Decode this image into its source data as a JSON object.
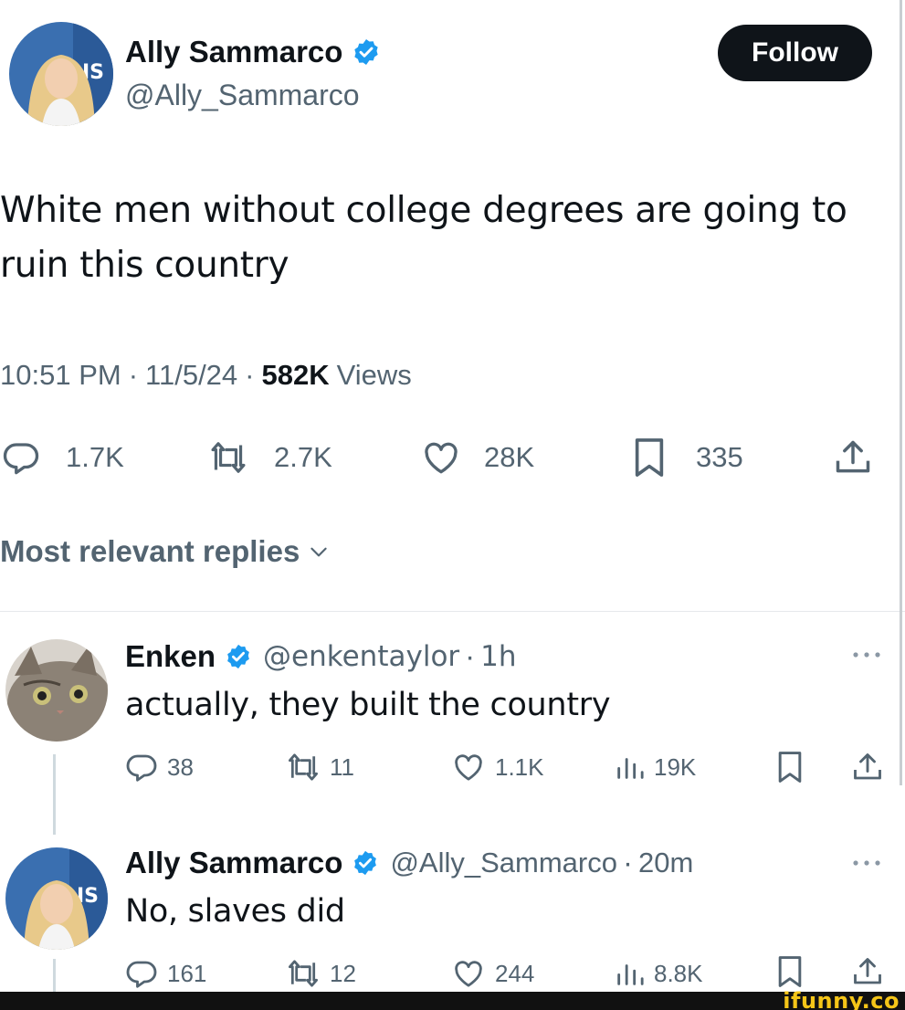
{
  "tweet": {
    "author_name": "Ally Sammarco",
    "handle": "@Ally_Sammarco",
    "follow_label": "Follow",
    "text_line1": "White men without college degrees are going to",
    "text_line2": "ruin this country",
    "time": "10:51 PM",
    "date": "11/5/24",
    "views_count": "582K",
    "views_label": "Views",
    "sep": "·",
    "actions": {
      "replies": "1.7K",
      "reposts": "2.7K",
      "likes": "28K",
      "bookmarks": "335"
    }
  },
  "replies_header": "Most relevant replies",
  "replies": [
    {
      "name": "Enken",
      "handle": "@enkentaylor",
      "age": "1h",
      "text": "actually, they built the country",
      "replies": "38",
      "reposts": "11",
      "likes": "1.1K",
      "views": "19K"
    },
    {
      "name": "Ally Sammarco",
      "handle": "@Ally_Sammarco",
      "age": "20m",
      "text": "No, slaves did",
      "replies": "161",
      "reposts": "12",
      "likes": "244",
      "views": "8.8K"
    }
  ],
  "watermark": "ifunny.co",
  "colors": {
    "verified": "#1d9bf0",
    "text": "#0f1419",
    "muted": "#536471",
    "follow_bg": "#0f1419"
  }
}
